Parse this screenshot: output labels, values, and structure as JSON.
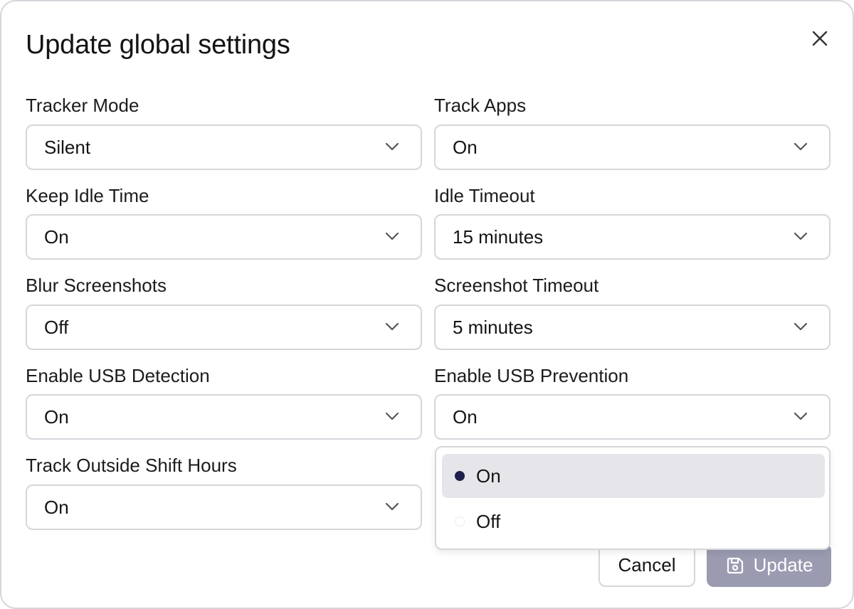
{
  "dialog": {
    "title": "Update global settings",
    "close_icon": "close-icon"
  },
  "fields": {
    "tracker_mode": {
      "label": "Tracker Mode",
      "value": "Silent"
    },
    "track_apps": {
      "label": "Track Apps",
      "value": "On"
    },
    "keep_idle_time": {
      "label": "Keep Idle Time",
      "value": "On"
    },
    "idle_timeout": {
      "label": "Idle Timeout",
      "value": "15 minutes"
    },
    "blur_screenshots": {
      "label": "Blur Screenshots",
      "value": "Off"
    },
    "screenshot_timeout": {
      "label": "Screenshot Timeout",
      "value": "5 minutes"
    },
    "enable_usb_detection": {
      "label": "Enable USB Detection",
      "value": "On"
    },
    "enable_usb_prevention": {
      "label": "Enable USB Prevention",
      "value": "On"
    },
    "track_outside_shift_hours": {
      "label": "Track Outside Shift Hours",
      "value": "On"
    }
  },
  "dropdown": {
    "options": [
      {
        "label": "On",
        "selected": true
      },
      {
        "label": "Off",
        "selected": false
      }
    ]
  },
  "footer": {
    "cancel_label": "Cancel",
    "update_label": "Update",
    "update_icon": "save-icon"
  },
  "colors": {
    "border": "#d6d6dc",
    "selected_option_bg": "#e6e5ea",
    "selected_dot": "#1e1f4a",
    "update_button_bg": "#9a9bb1"
  }
}
